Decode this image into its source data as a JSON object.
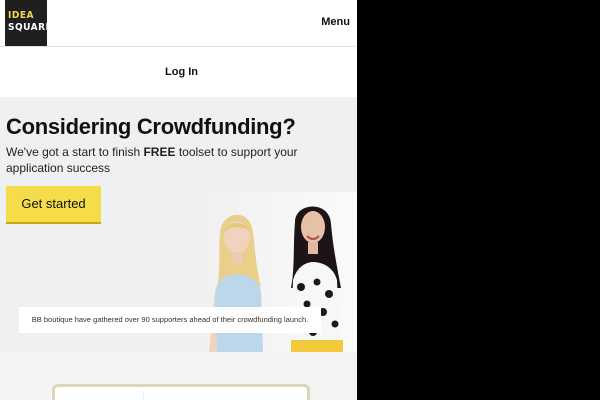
{
  "header": {
    "logo_line1": "IDEA",
    "logo_line2": "SQUARES",
    "menu_label": "Menu"
  },
  "nav": {
    "login_label": "Log In"
  },
  "hero": {
    "title": "Considering Crowdfunding?",
    "subtitle_before": "We've got a start to finish ",
    "subtitle_bold": "FREE",
    "subtitle_after": " toolset to support your application success",
    "cta_label": "Get started",
    "caption": "BB boutique have gathered over 90 supporters ahead of their crowdfunding launch."
  },
  "colors": {
    "accent_yellow": "#f5dc4a",
    "logo_bg": "#1f1f1f",
    "hero_bg": "#eff0f1"
  }
}
